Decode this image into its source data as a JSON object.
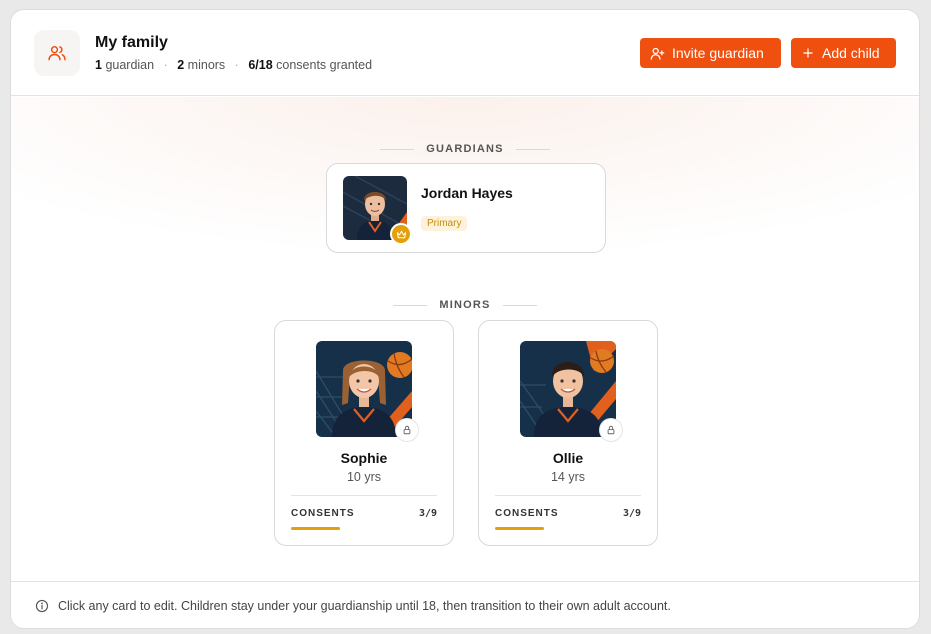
{
  "header": {
    "title": "My family",
    "stats": {
      "guardians_count": "1",
      "guardians_label": "guardian",
      "minors_count": "2",
      "minors_label": "minors",
      "consents_count": "6/18",
      "consents_label": "consents granted"
    },
    "invite_button": "Invite guardian",
    "add_child_button": "Add child"
  },
  "sections": {
    "guardians": "GUARDIANS",
    "minors": "MINORS"
  },
  "guardians": [
    {
      "name": "Jordan Hayes",
      "badge": "Primary"
    }
  ],
  "minors": [
    {
      "name": "Sophie",
      "age": "10 yrs",
      "consents_label": "CONSENTS",
      "consents_count": "3/9",
      "consents_fraction": 0.3333
    },
    {
      "name": "Ollie",
      "age": "14 yrs",
      "consents_label": "CONSENTS",
      "consents_count": "3/9",
      "consents_fraction": 0.3333
    }
  ],
  "footer": {
    "note": "Click any card to edit. Children stay under your guardianship until 18, then transition to their own adult account."
  },
  "colors": {
    "accent": "#f0500f",
    "consent_bar": "#e3a008",
    "primary_badge_text": "#c98a05",
    "primary_badge_bg": "#fdf3dc"
  },
  "icons": {
    "header": "family-icon",
    "invite": "user-plus-icon",
    "add": "plus-icon",
    "primary": "crown-icon",
    "minor_lock": "lock-icon",
    "footer": "info-icon"
  }
}
